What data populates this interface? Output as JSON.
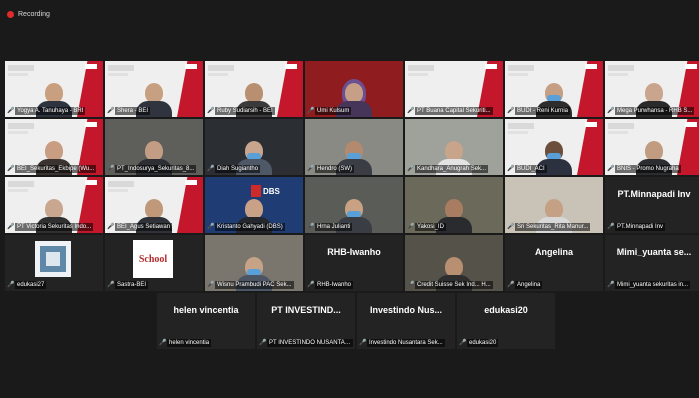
{
  "recording": {
    "label": "Recording"
  },
  "participants": [
    {
      "name": "Yogya A. Tanuhaya - BRI",
      "type": "slide",
      "bg": "#efefef",
      "skin": "#c8a080",
      "shirt": "#2e3340"
    },
    {
      "name": "Shera - BEI",
      "type": "slide",
      "bg": "#efefef",
      "skin": "#c7a082",
      "shirt": "#30343e",
      "hijab": "#f0f0f0",
      "active": true
    },
    {
      "name": "Ruby Sudiarsih - BEI",
      "type": "slide",
      "bg": "#efefef",
      "skin": "#b98f72",
      "shirt": "#3a3a3a"
    },
    {
      "name": "Umi Kulsum",
      "type": "room",
      "bg": "#8f1d20",
      "skin": "#c79f86",
      "shirt": "#463459",
      "hijab": "#6b4f93"
    },
    {
      "name": "PT Buana Capital Sekuriti...",
      "type": "slide",
      "bg": "#efefef"
    },
    {
      "name": "BUDI - Reni Kurnia",
      "type": "slide",
      "bg": "#efefef",
      "skin": "#c59f84",
      "shirt": "#2d2d2d",
      "mask": true
    },
    {
      "name": "Mega Purwhansa - RHB S...",
      "type": "slide",
      "bg": "#efefef",
      "skin": "#c9a58d",
      "shirt": "#2a2a2a"
    },
    {
      "name": "BEI_Sekuritas_Ekbipe (Wu...",
      "type": "slide",
      "bg": "#efefef",
      "skin": "#c89d82",
      "shirt": "#3a3330"
    },
    {
      "name": "PT_Indosurya_Sekuritas_8...",
      "type": "room",
      "bg": "#5e5f5a",
      "skin": "#c29d84",
      "shirt": "#2d2f34"
    },
    {
      "name": "Diah Sugiantho",
      "type": "room",
      "bg": "#2b2e33",
      "skin": "#c9a58d",
      "shirt": "#4e5866",
      "mask": true
    },
    {
      "name": "Hendro (SW)",
      "type": "room",
      "bg": "#8a8a84",
      "skin": "#b48a6e",
      "shirt": "#3a3d44",
      "mask": true
    },
    {
      "name": "Kandhara_Anugrah Sek...",
      "type": "room",
      "bg": "#9fa19b",
      "skin": "#c8a48a",
      "shirt": "#e3e3e3"
    },
    {
      "name": "BUDI_ACI",
      "type": "slide",
      "bg": "#efefef",
      "skin": "#6b4e3c",
      "shirt": "#2c3140",
      "mask": true
    },
    {
      "name": "BNIS - Promo Nugraha",
      "type": "slide",
      "bg": "#efefef",
      "skin": "#c29c80",
      "shirt": "#2b2d31"
    },
    {
      "name": "PT Victoria Sekuritas Indo...",
      "type": "slide",
      "bg": "#efefef",
      "skin": "#c9a68f",
      "shirt": "#303030"
    },
    {
      "name": "BEI_Agus Setiawan",
      "type": "slide",
      "bg": "#efefef",
      "skin": "#bf9979",
      "shirt": "#2f3339"
    },
    {
      "name": "Kristanto Gahyadi (DBS)",
      "type": "dbs",
      "skin": "#c8a187",
      "shirt": "#24272d"
    },
    {
      "name": "Hrna Julianti",
      "type": "room",
      "bg": "#5a5c58",
      "skin": "#c9a183",
      "shirt": "#3b3d44",
      "mask": true
    },
    {
      "name": "Yakosi_ID",
      "type": "room",
      "bg": "#6b6a5a",
      "skin": "#a77c60",
      "shirt": "#2a2b2f"
    },
    {
      "name": "Sri Sekuritas_Rita Manur...",
      "type": "room",
      "bg": "#c9c2b7",
      "skin": "#c4a085",
      "shirt": "#d8d8d8"
    },
    {
      "name": "PT.Minnapadi Inv",
      "type": "nameonly"
    },
    {
      "name": "edukasi27",
      "type": "logo"
    },
    {
      "name": "Sastra-BEI",
      "type": "school"
    },
    {
      "name": "Wisnu Prambudi PAC Sek...",
      "type": "room",
      "bg": "#7a766d",
      "skin": "#c6a286",
      "shirt": "#4c5564",
      "mask": true
    },
    {
      "name": "RHB-Iwanho",
      "type": "nameonly",
      "display": "RHB-Iwanho"
    },
    {
      "name": "Credit Suisse Sek Ind... H...",
      "type": "room",
      "bg": "#55524a",
      "skin": "#b98f72",
      "shirt": "#2e2e2e"
    },
    {
      "name": "Angelina",
      "type": "nameonly",
      "display": "Angelina"
    },
    {
      "name": "Mimi_yuanta sekuritas in...",
      "type": "nameonly",
      "display": "Mimi_yuanta se..."
    },
    {
      "name": "helen vincentia",
      "type": "nameonly",
      "display": "helen vincentia"
    },
    {
      "name": "PT INVESTINDO NUSANTAR...",
      "type": "nameonly",
      "display": "PT INVESTIND..."
    },
    {
      "name": "Investindo Nusantara Sek...",
      "type": "nameonly",
      "display": "Investindo Nus..."
    },
    {
      "name": "edukasi20",
      "type": "nameonly",
      "display": "edukasi20"
    }
  ],
  "colors": {
    "mic_muted": "#e24a4a",
    "active_border": "#e7d64a",
    "slide_accent": "#c4172c"
  }
}
